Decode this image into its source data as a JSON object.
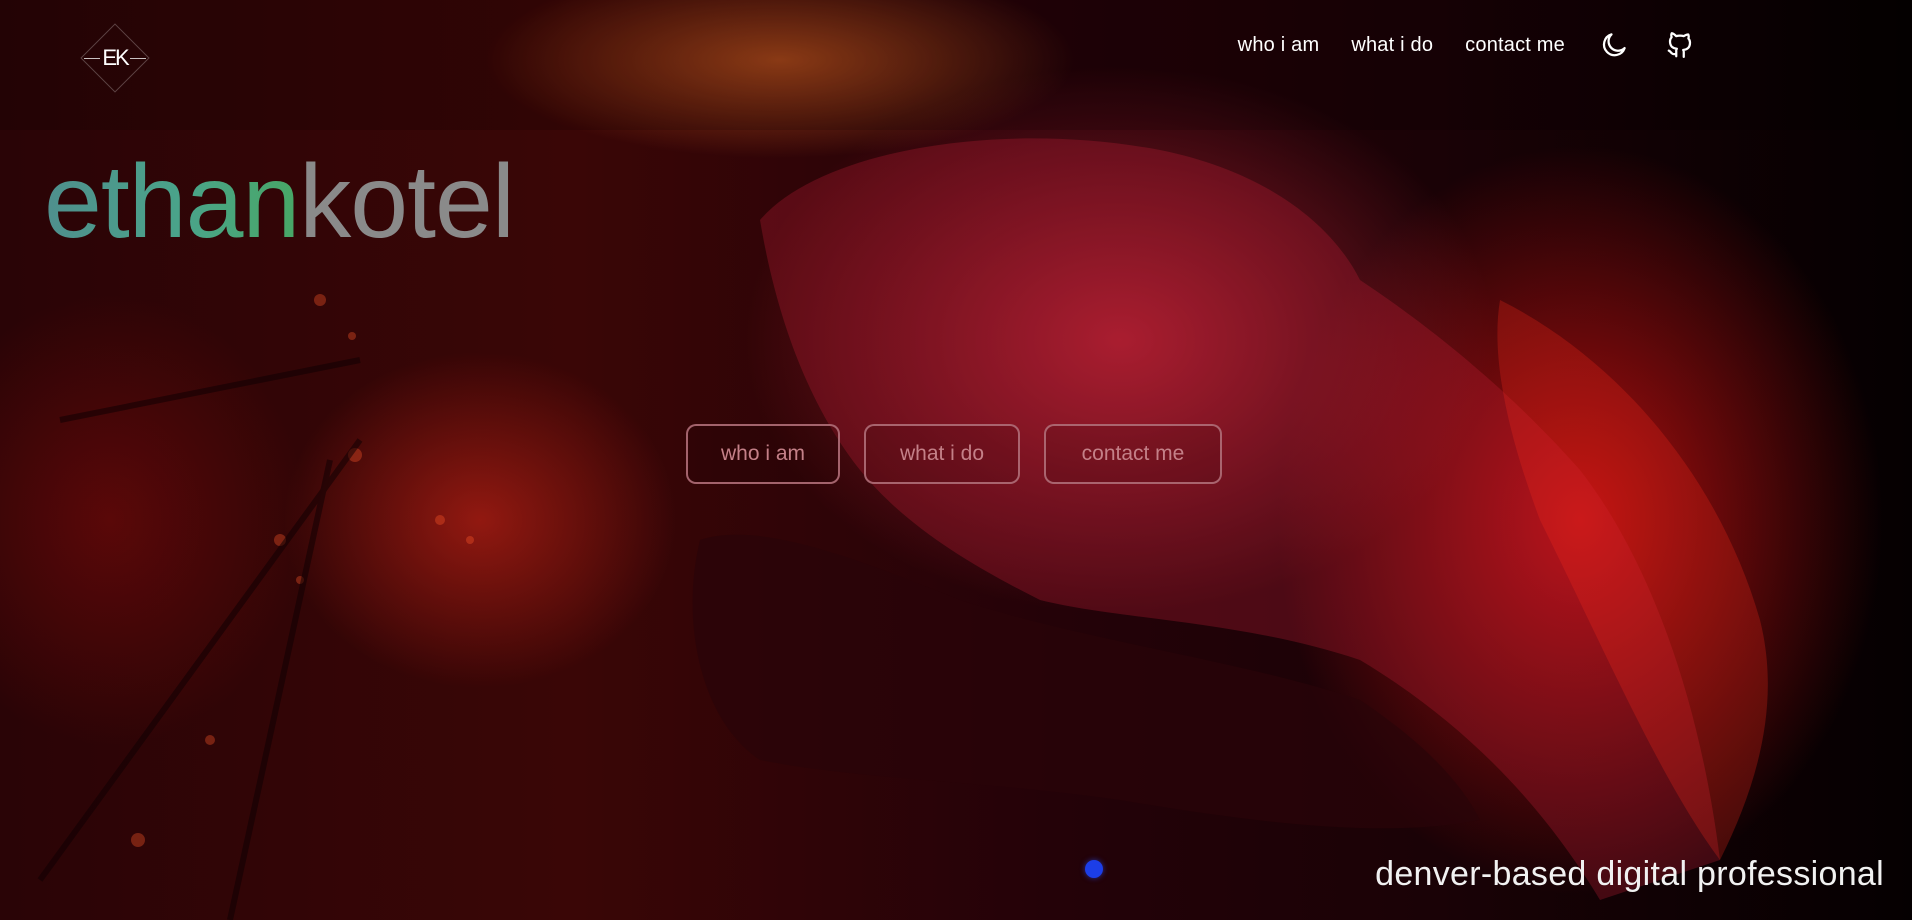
{
  "brand": {
    "logo_monogram": "EK",
    "logo_icon": "monogram-diamond-logo"
  },
  "nav": {
    "items": [
      {
        "label": "who i am"
      },
      {
        "label": "what i do"
      },
      {
        "label": "contact me"
      }
    ],
    "icons": {
      "theme_toggle": "moon-icon",
      "repo": "github-icon"
    }
  },
  "hero": {
    "name_first": "ethan",
    "name_last": "kotel",
    "buttons": [
      {
        "label": "who i am"
      },
      {
        "label": "what i do"
      },
      {
        "label": "contact me"
      }
    ],
    "tagline": "denver-based digital professional"
  },
  "colors": {
    "name_first_gradient_start": "#4f8f8d",
    "name_first_gradient_end": "#48a765",
    "name_last": "#8a8a8a",
    "cta_border": "#b06e78",
    "cta_text": "#c48088",
    "carousel_dot": "#1c3ee8"
  }
}
